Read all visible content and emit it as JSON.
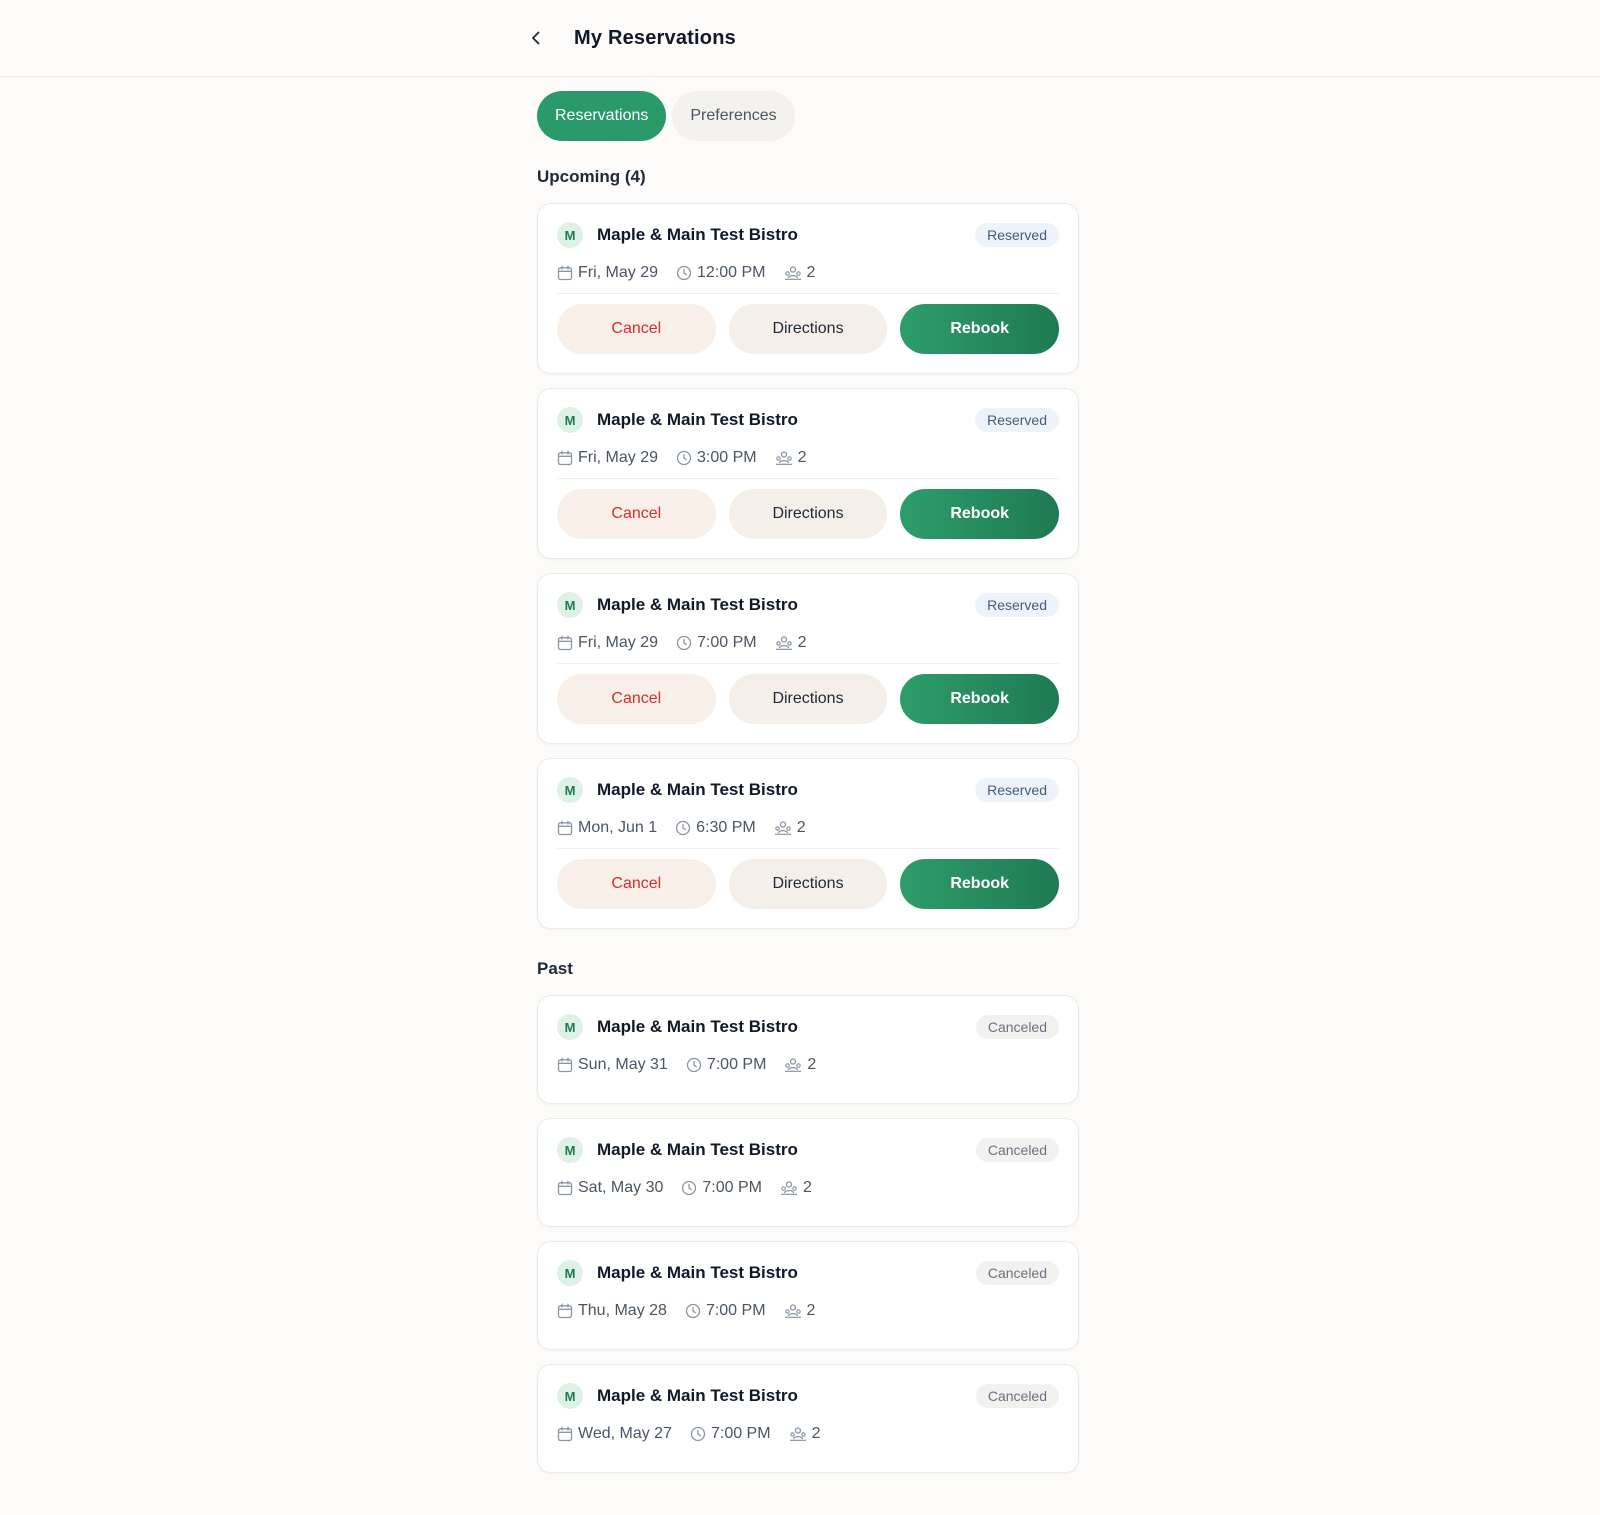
{
  "header": {
    "title": "My Reservations"
  },
  "tabs": [
    {
      "label": "Reservations",
      "active": true
    },
    {
      "label": "Preferences",
      "active": false
    }
  ],
  "upcoming": {
    "title": "Upcoming (4)",
    "actions": {
      "cancel": "Cancel",
      "directions": "Directions",
      "rebook": "Rebook"
    },
    "items": [
      {
        "initial": "M",
        "name": "Maple & Main Test Bistro",
        "status": "Reserved",
        "date": "Fri, May 29",
        "time": "12:00 PM",
        "guests": "2"
      },
      {
        "initial": "M",
        "name": "Maple & Main Test Bistro",
        "status": "Reserved",
        "date": "Fri, May 29",
        "time": "3:00 PM",
        "guests": "2"
      },
      {
        "initial": "M",
        "name": "Maple & Main Test Bistro",
        "status": "Reserved",
        "date": "Fri, May 29",
        "time": "7:00 PM",
        "guests": "2"
      },
      {
        "initial": "M",
        "name": "Maple & Main Test Bistro",
        "status": "Reserved",
        "date": "Mon, Jun 1",
        "time": "6:30 PM",
        "guests": "2"
      }
    ]
  },
  "past": {
    "title": "Past",
    "items": [
      {
        "initial": "M",
        "name": "Maple & Main Test Bistro",
        "status": "Canceled",
        "date": "Sun, May 31",
        "time": "7:00 PM",
        "guests": "2"
      },
      {
        "initial": "M",
        "name": "Maple & Main Test Bistro",
        "status": "Canceled",
        "date": "Sat, May 30",
        "time": "7:00 PM",
        "guests": "2"
      },
      {
        "initial": "M",
        "name": "Maple & Main Test Bistro",
        "status": "Canceled",
        "date": "Thu, May 28",
        "time": "7:00 PM",
        "guests": "2"
      },
      {
        "initial": "M",
        "name": "Maple & Main Test Bistro",
        "status": "Canceled",
        "date": "Wed, May 27",
        "time": "7:00 PM",
        "guests": "2"
      }
    ]
  },
  "colors": {
    "accent": "#2a9a6a",
    "cancel_text": "#d32f2f",
    "reserved_badge_bg": "#eef3fb",
    "canceled_badge_bg": "#f1f1f0"
  },
  "icons": {
    "back": "chevron-left-icon",
    "date": "calendar-icon",
    "time": "clock-icon",
    "guests": "people-icon"
  }
}
